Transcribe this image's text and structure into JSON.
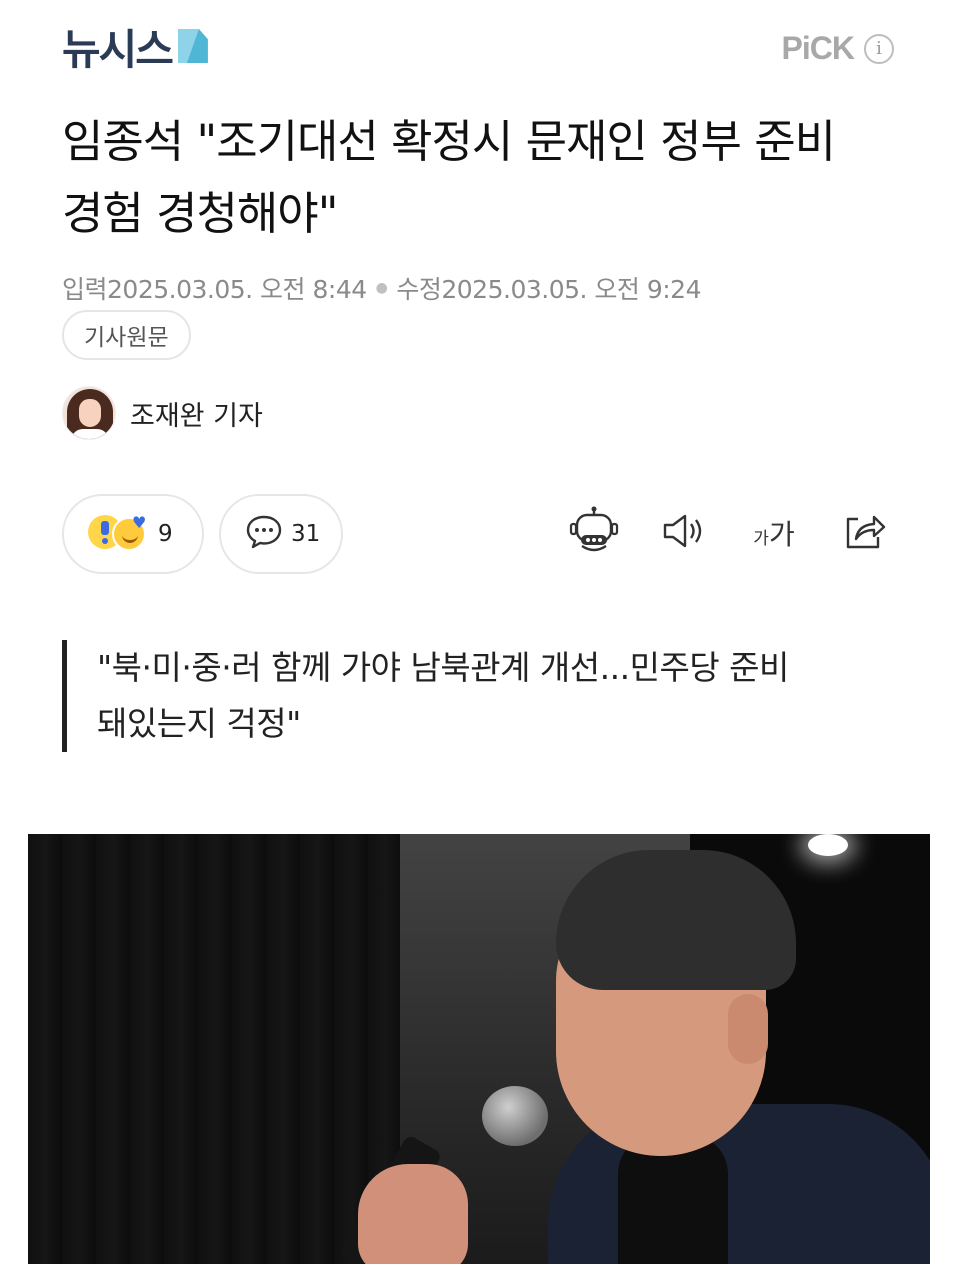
{
  "header": {
    "logo_text": "뉴시스",
    "pick_label": "PiCK",
    "info_icon": "i"
  },
  "article": {
    "headline": "임종석 \"조기대선 확정시 문재인 정부 준비 경험 경청해야\"",
    "input_label": "입력",
    "input_datetime": "2025.03.05. 오전 8:44",
    "modified_label": "수정",
    "modified_datetime": "2025.03.05. 오전 9:24",
    "original_button": "기사원문",
    "reporter": "조재완 기자",
    "subtitle": "\"북·미·중·러 함께 가야 남북관계 개선...민주당 준비 돼있는지 걱정\""
  },
  "actions": {
    "reaction_count": "9",
    "comment_count": "31",
    "font_small": "가",
    "font_large": "가"
  },
  "colors": {
    "logo": "#2b3a55",
    "logo_accent": "#4fb6d6",
    "meta_text": "#8a8a8a",
    "emoji_blue": "#3b6be0"
  },
  "icons": [
    "robot-summary-icon",
    "speaker-icon",
    "font-size-icon",
    "share-icon",
    "comment-icon",
    "reaction-emoji-icon"
  ]
}
